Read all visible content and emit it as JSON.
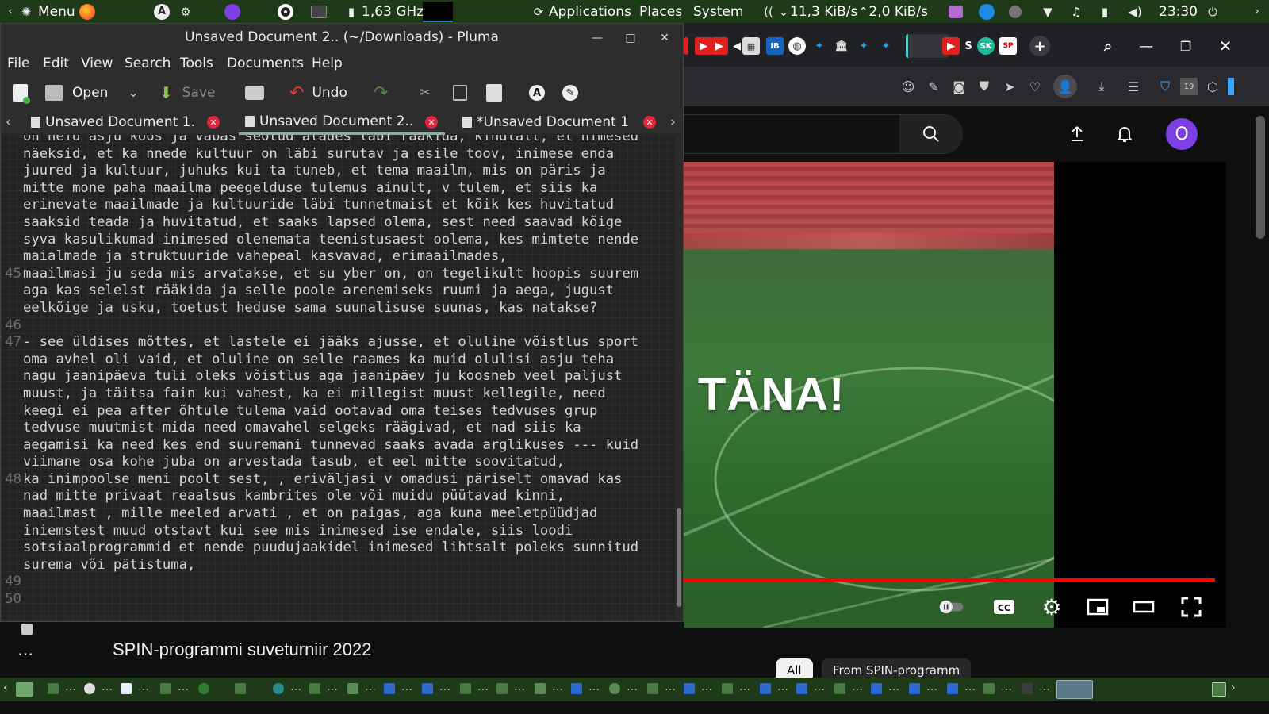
{
  "top_panel": {
    "menu_label": "Menu",
    "cpu_label": "1,63 GHz",
    "applications_label": "Applications",
    "places_label": "Places",
    "system_label": "System",
    "net_down": "11,3 KiB/s",
    "net_up": "2,0 KiB/s",
    "clock": "23:30"
  },
  "pluma": {
    "window_title": "Unsaved Document 2.. (~/Downloads) - Pluma",
    "menu": [
      "File",
      "Edit",
      "View",
      "Search",
      "Tools",
      "Documents",
      "Help"
    ],
    "toolbar": {
      "open_label": "Open",
      "save_label": "Save",
      "undo_label": "Undo"
    },
    "tabs": [
      "Unsaved Document 1.",
      "Unsaved Document 2..",
      "*Unsaved Document 1"
    ],
    "lines": [
      {
        "num": "",
        "text": "on neid asju koos ja vabas seotud alades läbi rääkida, kindlalt, et nimesed"
      },
      {
        "num": "",
        "text": "näeksid, et ka nnede kultuur on läbi surutav ja esile toov, inimese enda"
      },
      {
        "num": "",
        "text": "juured ja kultuur, juhuks kui ta tuneb, et tema maailm, mis on päris ja"
      },
      {
        "num": "",
        "text": "mitte mone paha maailma peegelduse tulemus ainult, v tulem, et siis ka"
      },
      {
        "num": "",
        "text": "erinevate maailmade ja kultuuride läbi tunnetmaist et kõik kes huvitatud"
      },
      {
        "num": "",
        "text": "saaksid teada ja huvitatud, et saaks lapsed olema, sest need saavad kõige"
      },
      {
        "num": "",
        "text": "syva kasulikumad inimesed olenemata teenistusaest oolema, kes mimtete nende"
      },
      {
        "num": "",
        "text": "maialmade ja struktuuride vahepeal kasvavad, erimaailmades,"
      },
      {
        "num": "45",
        "text": "maailmasi ju seda mis arvatakse, et su yber on, on tegelikult hoopis suurem"
      },
      {
        "num": "",
        "text": "aga kas selelst rääkida ja selle poole arenemiseks ruumi ja aega, jugust"
      },
      {
        "num": "",
        "text": "eelkõige ja usku, toetust heduse sama suunalisuse suunas, kas natakse?"
      },
      {
        "num": "46",
        "text": ""
      },
      {
        "num": "47",
        "text": "- see üldises mõttes, et lastele ei jääks ajusse, et oluline võistlus sport"
      },
      {
        "num": "",
        "text": "oma avhel oli vaid, et oluline on selle raames ka muid olulisi asju teha"
      },
      {
        "num": "",
        "text": "nagu jaanipäeva tuli oleks võistlus aga jaanipäev ju koosneb veel paljust"
      },
      {
        "num": "",
        "text": "muust, ja täitsa fain kui vahest, ka ei millegist muust kellegile, need"
      },
      {
        "num": "",
        "text": "keegi ei pea after õhtule tulema vaid ootavad oma teises tedvuses grup"
      },
      {
        "num": "",
        "text": "tedvuse muutmist mida need omavahel selgeks räägivad, et nad siis ka"
      },
      {
        "num": "",
        "text": "aegamisi ka need kes end suuremani tunnevad saaks avada arglikuses --- kuid"
      },
      {
        "num": "",
        "text": "viimane osa kohe juba on arvestada tasub, et eel mitte soovitatud,"
      },
      {
        "num": "48",
        "text": "ka inimpoolse meni poolt sest, , eriväljasi v omadusi päriselt omavad kas"
      },
      {
        "num": "",
        "text": "nad mitte privaat reaalsus kambrites ole või muidu püütavad kinni,"
      },
      {
        "num": "",
        "text": "maailmast , mille meeled arvati , et on paigas, aga kuna meeletpüüdjad"
      },
      {
        "num": "",
        "text": "iniemstest muud otstavt kui see mis inimesed ise endale, siis loodi"
      },
      {
        "num": "",
        "text": "sotsiaalprogrammid et nende puudujaakidel inimesed lihtsalt poleks sunnitud"
      },
      {
        "num": "",
        "text": "surema või pätistuma,"
      },
      {
        "num": "49",
        "text": ""
      },
      {
        "num": "50",
        "text": ""
      }
    ]
  },
  "youtube": {
    "overlay_text": "TÄNA!",
    "video_title": "SPIN-programmi suveturniir 2022",
    "chips": [
      "All",
      "From SPIN-programm"
    ],
    "avatar_letter": "O",
    "colors": {
      "progress": "#ff0000",
      "avatar": "#7b3fe4"
    }
  }
}
